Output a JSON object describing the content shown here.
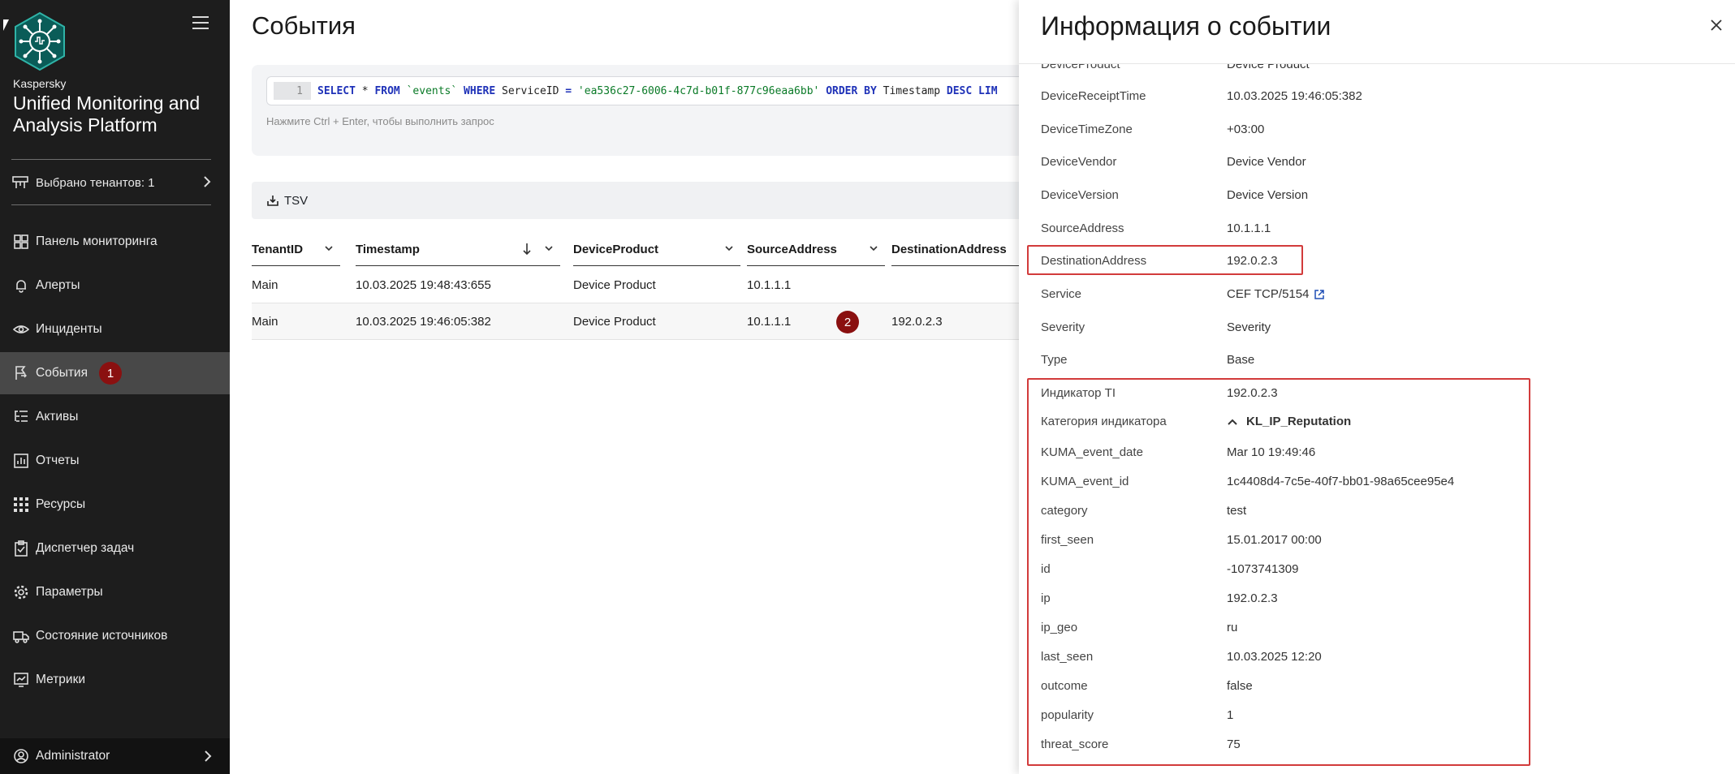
{
  "sidebar": {
    "brand_small": "Kaspersky",
    "brand_title": "Unified Monitoring and Analysis Platform",
    "tenant_label": "Выбрано тенантов: 1",
    "items": [
      {
        "label": "Панель мониторинга",
        "icon": "dashboard-icon"
      },
      {
        "label": "Алерты",
        "icon": "bell-icon"
      },
      {
        "label": "Инциденты",
        "icon": "eye-icon"
      },
      {
        "label": "События",
        "icon": "flag-icon",
        "badge": "1"
      },
      {
        "label": "Активы",
        "icon": "list-icon"
      },
      {
        "label": "Отчеты",
        "icon": "report-icon"
      },
      {
        "label": "Ресурсы",
        "icon": "grid-icon"
      },
      {
        "label": "Диспетчер задач",
        "icon": "clipboard-icon"
      },
      {
        "label": "Параметры",
        "icon": "gear-icon"
      },
      {
        "label": "Состояние источников",
        "icon": "truck-icon"
      },
      {
        "label": "Метрики",
        "icon": "chart-icon"
      }
    ],
    "user": "Administrator",
    "accent": "#484848",
    "badge_color": "#8a1010"
  },
  "main": {
    "title": "События",
    "query": {
      "line_number": "1",
      "tokens": [
        {
          "t": "SELECT",
          "c": "kw"
        },
        {
          "t": " * ",
          "c": "plain"
        },
        {
          "t": "FROM",
          "c": "kw"
        },
        {
          "t": " `events` ",
          "c": "str"
        },
        {
          "t": "WHERE",
          "c": "kw"
        },
        {
          "t": " ServiceID ",
          "c": "plain"
        },
        {
          "t": "=",
          "c": "kw"
        },
        {
          "t": " 'ea536c27-6006-4c7d-b01f-877c96eaa6bb' ",
          "c": "str"
        },
        {
          "t": "ORDER BY",
          "c": "kw"
        },
        {
          "t": " Timestamp ",
          "c": "plain"
        },
        {
          "t": "DESC",
          "c": "kw"
        },
        {
          "t": " ",
          "c": "plain"
        },
        {
          "t": "LIM",
          "c": "kw"
        }
      ],
      "hint": "Нажмите Ctrl + Enter, чтобы выполнить запрос"
    },
    "export_label": "TSV",
    "columns": [
      "TenantID",
      "Timestamp",
      "DeviceProduct",
      "SourceAddress",
      "DestinationAddress"
    ],
    "rows": [
      [
        "Main",
        "10.03.2025 19:48:43:655",
        "Device Product",
        "10.1.1.1",
        ""
      ],
      [
        "Main",
        "10.03.2025 19:46:05:382",
        "Device Product",
        "10.1.1.1",
        "192.0.2.3"
      ]
    ],
    "row_badge": "2"
  },
  "panel": {
    "title": "Информация о событии",
    "fields": [
      {
        "k": "DeviceProduct",
        "v": "Device Product"
      },
      {
        "k": "DeviceReceiptTime",
        "v": "10.03.2025 19:46:05:382"
      },
      {
        "k": "DeviceTimeZone",
        "v": "+03:00"
      },
      {
        "k": "DeviceVendor",
        "v": "Device Vendor"
      },
      {
        "k": "DeviceVersion",
        "v": "Device Version"
      },
      {
        "k": "SourceAddress",
        "v": "10.1.1.1"
      },
      {
        "k": "DestinationAddress",
        "v": "192.0.2.3"
      },
      {
        "k": "Service",
        "v": "CEF TCP/5154"
      },
      {
        "k": "Severity",
        "v": "Severity"
      },
      {
        "k": "Type",
        "v": "Base"
      }
    ],
    "ti_fields": [
      {
        "k": "Индикатор TI",
        "v": "192.0.2.3"
      },
      {
        "k": "Категория индикатора",
        "v": "KL_IP_Reputation"
      },
      {
        "k": "KUMA_event_date",
        "v": "Mar 10 19:49:46"
      },
      {
        "k": "KUMA_event_id",
        "v": "1c4408d4-7c5e-40f7-bb01-98a65cee95e4"
      },
      {
        "k": "category",
        "v": "test"
      },
      {
        "k": "first_seen",
        "v": "15.01.2017 00:00"
      },
      {
        "k": "id",
        "v": "-1073741309"
      },
      {
        "k": "ip",
        "v": "192.0.2.3"
      },
      {
        "k": "ip_geo",
        "v": "ru"
      },
      {
        "k": "last_seen",
        "v": "10.03.2025 12:20"
      },
      {
        "k": "outcome",
        "v": "false"
      },
      {
        "k": "popularity",
        "v": "1"
      },
      {
        "k": "threat_score",
        "v": "75"
      }
    ],
    "highlight_color": "#d23b3b",
    "link_color": "#1f4fb5"
  }
}
